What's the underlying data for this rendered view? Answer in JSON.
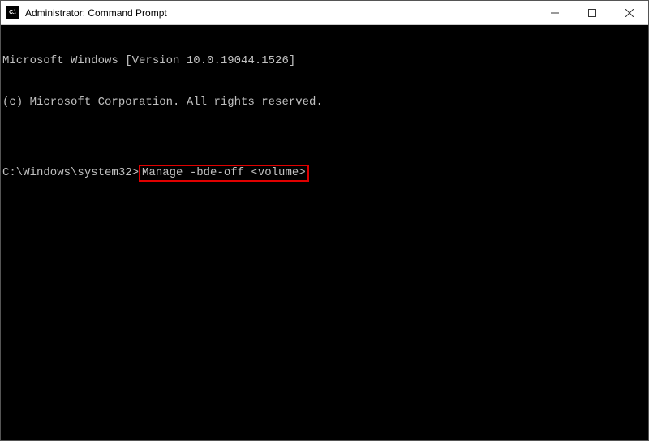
{
  "titlebar": {
    "icon_label": "C:\\",
    "title": "Administrator: Command Prompt"
  },
  "controls": {
    "minimize": "minimize",
    "maximize": "maximize",
    "close": "close"
  },
  "terminal": {
    "line1": "Microsoft Windows [Version 10.0.19044.1526]",
    "line2": "(c) Microsoft Corporation. All rights reserved.",
    "blank": "",
    "prompt": "C:\\Windows\\system32>",
    "command": "Manage -bde-off <volume>"
  },
  "colors": {
    "highlight_border": "#e00000",
    "terminal_bg": "#000000",
    "terminal_fg": "#c0c0c0"
  }
}
